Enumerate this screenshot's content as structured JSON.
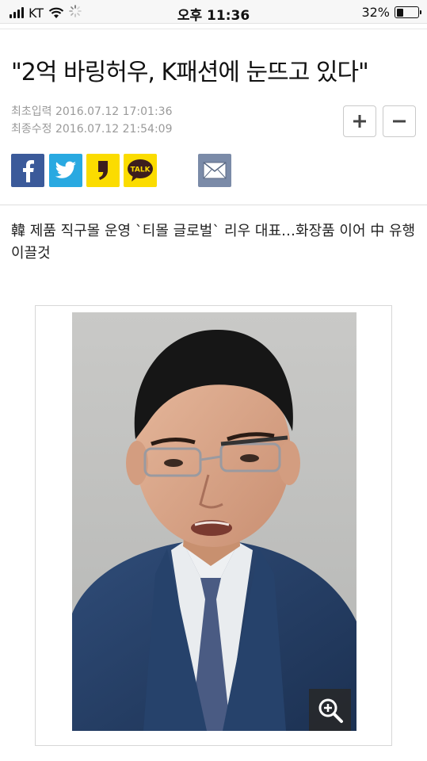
{
  "status_bar": {
    "carrier": "KT",
    "time": "오후 11:36",
    "battery_percent": "32%",
    "battery_level": 0.32
  },
  "article": {
    "headline": "\"2억 바링허우, K패션에 눈뜨고 있다\"",
    "first_input_label": "최초입력",
    "first_input_time": "2016.07.12 17:01:36",
    "last_edit_label": "최종수정",
    "last_edit_time": "2016.07.12 21:54:09",
    "subtitle": "韓 제품 직구몰 운영 `티몰 글로벌` 리우 대표…화장품 이어 中 유행 이끌것"
  },
  "font_controls": {
    "increase_icon": "plus-icon",
    "decrease_icon": "minus-icon"
  },
  "share": {
    "facebook_icon": "facebook-icon",
    "twitter_icon": "twitter-icon",
    "kakaostory_icon": "kakaostory-icon",
    "kakaotalk_label": "TALK",
    "email_icon": "mail-icon"
  },
  "photo": {
    "zoom_icon": "zoom-in-icon"
  },
  "colors": {
    "facebook": "#3b5a9a",
    "twitter": "#29a9e1",
    "kakao": "#fbdc00",
    "email": "#7b8ba8"
  }
}
